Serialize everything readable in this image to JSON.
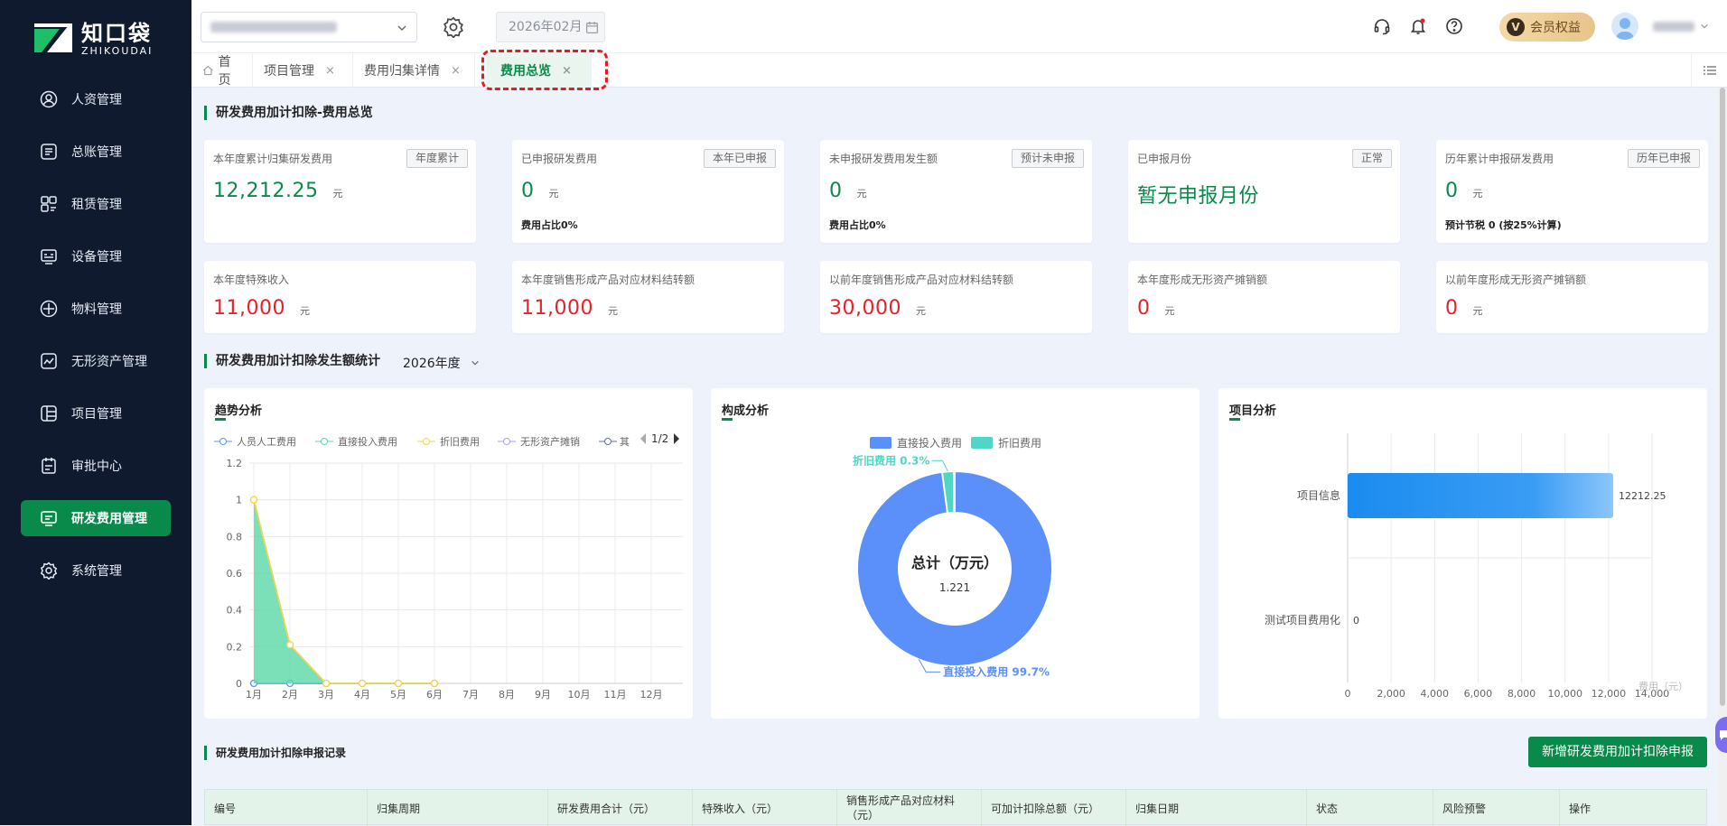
{
  "app": {
    "logo_cn": "知口袋",
    "logo_en": "ZHIKOUDAI"
  },
  "sidebar": {
    "items": [
      {
        "label": "人资管理"
      },
      {
        "label": "总账管理"
      },
      {
        "label": "租赁管理"
      },
      {
        "label": "设备管理"
      },
      {
        "label": "物料管理"
      },
      {
        "label": "无形资产管理"
      },
      {
        "label": "项目管理"
      },
      {
        "label": "审批中心"
      },
      {
        "label": "研发费用管理"
      },
      {
        "label": "系统管理"
      }
    ]
  },
  "topbar": {
    "month": "2026年02月",
    "vip_label": "会员权益",
    "vip_badge": "V"
  },
  "tabs": [
    {
      "label": "首页"
    },
    {
      "label": "项目管理",
      "close": "×"
    },
    {
      "label": "费用归集详情",
      "close": "×"
    },
    {
      "label": "费用总览",
      "close": "×"
    }
  ],
  "section1": {
    "title": "研发费用加计扣除-费用总览"
  },
  "cards_row1": [
    {
      "label": "本年度累计归集研发费用",
      "tag": "年度累计",
      "value": "12,212.25",
      "unit": "元",
      "sub": ""
    },
    {
      "label": "已申报研发费用",
      "tag": "本年已申报",
      "value": "0",
      "unit": "元",
      "sub": "费用占比0%"
    },
    {
      "label": "未申报研发费用发生额",
      "tag": "预计未申报",
      "value": "0",
      "unit": "元",
      "sub": "费用占比0%"
    },
    {
      "label": "已申报月份",
      "tag": "正常",
      "value": "暂无申报月份",
      "unit": "",
      "sub": ""
    },
    {
      "label": "历年累计申报研发费用",
      "tag": "历年已申报",
      "value": "0",
      "unit": "元",
      "sub": "预计节税 0 (按25%计算)"
    }
  ],
  "cards_row2": [
    {
      "label": "本年度特殊收入",
      "value": "11,000",
      "unit": "元"
    },
    {
      "label": "本年度销售形成产品对应材料结转额",
      "value": "11,000",
      "unit": "元"
    },
    {
      "label": "以前年度销售形成产品对应材料结转额",
      "value": "30,000",
      "unit": "元"
    },
    {
      "label": "本年度形成无形资产摊销额",
      "value": "0",
      "unit": "元"
    },
    {
      "label": "以前年度形成无形资产摊销额",
      "value": "0",
      "unit": "元"
    }
  ],
  "section2": {
    "title": "研发费用加计扣除发生额统计",
    "year": "2026年度"
  },
  "trend": {
    "title": "趋势分析",
    "pager": "1/2",
    "legend": [
      "人员人工费用",
      "直接投入费用",
      "折旧费用",
      "无形资产摊销",
      "其"
    ]
  },
  "composition": {
    "title": "构成分析",
    "center_title": "总计（万元）",
    "center_value": "1.221"
  },
  "project": {
    "title": "项目分析",
    "axis_unit": "费用（元）"
  },
  "chart_data": [
    {
      "type": "line",
      "title": "趋势分析",
      "x": [
        "1月",
        "2月",
        "3月",
        "4月",
        "5月",
        "6月",
        "7月",
        "8月",
        "9月",
        "10月",
        "11月",
        "12月"
      ],
      "ylim": [
        0,
        1.2
      ],
      "yticks": [
        "0",
        "0.2",
        "0.4",
        "0.6",
        "0.8",
        "1",
        "1.2"
      ],
      "series": [
        {
          "name": "人员人工费用",
          "values": [
            0,
            0,
            0,
            0,
            0,
            0,
            null,
            null,
            null,
            null,
            null,
            null
          ],
          "color": "#5b8ff9"
        },
        {
          "name": "直接投入费用",
          "values": [
            1,
            0.21,
            0,
            0,
            0,
            0,
            null,
            null,
            null,
            null,
            null,
            null
          ],
          "color": "#5ad8a6",
          "area": true
        },
        {
          "name": "折旧费用",
          "values": [
            1,
            0.21,
            0,
            0,
            0,
            0,
            null,
            null,
            null,
            null,
            null,
            null
          ],
          "color": "#f6d54a"
        }
      ],
      "grid": true,
      "legend": "top"
    },
    {
      "type": "pie",
      "title": "构成分析",
      "legend": "top",
      "slices": [
        {
          "name": "直接投入费用",
          "value": 99.7,
          "label": "直接投入费用 99.7%",
          "color": "#5b8ff9"
        },
        {
          "name": "折旧费用",
          "value": 0.3,
          "label": "折旧费用 0.3%",
          "color": "#4fd6c4"
        }
      ]
    },
    {
      "type": "bar",
      "orientation": "horizontal",
      "title": "项目分析",
      "categories": [
        "项目信息",
        "测试项目费用化"
      ],
      "values": [
        12212.25,
        0
      ],
      "value_labels": [
        "12212.25",
        "0"
      ],
      "xlim": [
        0,
        14000
      ],
      "xticks": [
        "0",
        "2,000",
        "4,000",
        "6,000",
        "8,000",
        "10,000",
        "12,000",
        "14,000"
      ],
      "xlabel": "费用（元）",
      "grid": true
    }
  ],
  "records": {
    "title": "研发费用加计扣除申报记录",
    "add_button": "新增研发费用加计扣除申报",
    "columns": [
      "编号",
      "归集周期",
      "研发费用合计（元）",
      "特殊收入（元）",
      "销售形成产品对应材料（元）",
      "可加计扣除总额（元）",
      "归集日期",
      "状态",
      "风险预警",
      "操作"
    ]
  },
  "colors": {
    "sidebar_bg": "#0f1a2e",
    "accent": "#0a8a4a",
    "red": "#e8202a",
    "highlight": "#e11d1d"
  }
}
